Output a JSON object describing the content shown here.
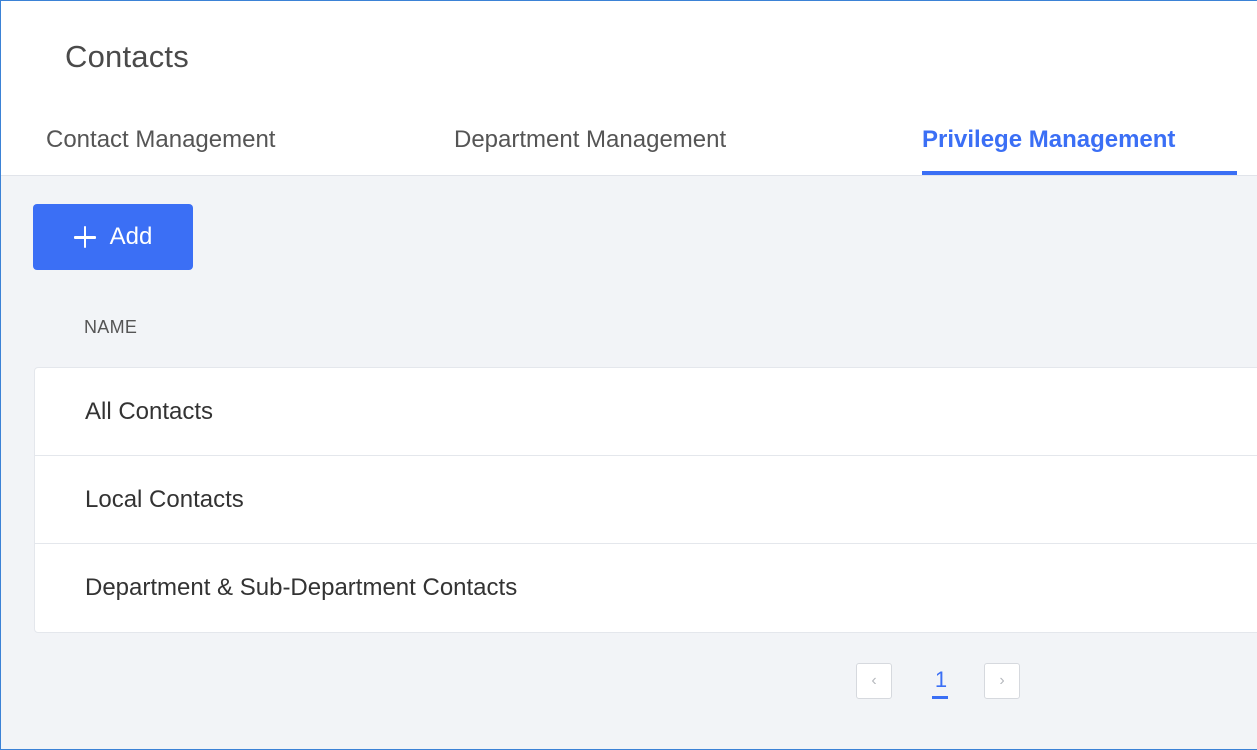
{
  "page": {
    "title": "Contacts"
  },
  "tabs": [
    {
      "label": "Contact Management",
      "active": false
    },
    {
      "label": "Department Management",
      "active": false
    },
    {
      "label": "Privilege Management",
      "active": true
    }
  ],
  "toolbar": {
    "add_label": "Add",
    "add_icon": "plus-icon"
  },
  "table": {
    "columns": [
      "NAME"
    ],
    "rows": [
      {
        "name": "All Contacts"
      },
      {
        "name": "Local Contacts"
      },
      {
        "name": "Department & Sub-Department Contacts"
      }
    ]
  },
  "pagination": {
    "prev_icon": "chevron-left-icon",
    "current_page": "1",
    "next_icon": "chevron-right-icon"
  },
  "colors": {
    "accent": "#3b6ff5",
    "frame_border": "#3b82d6",
    "content_background": "#f2f4f7"
  }
}
